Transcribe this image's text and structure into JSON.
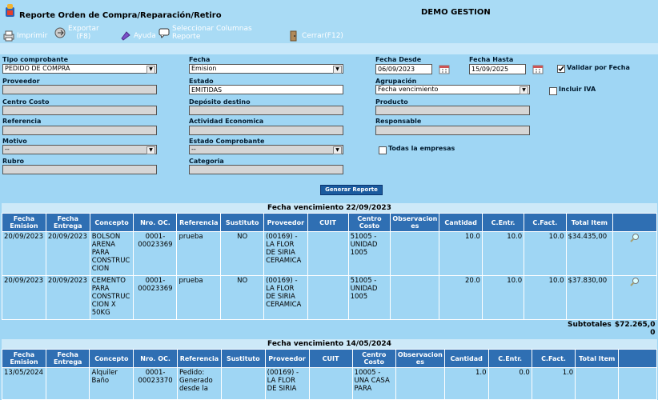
{
  "app": {
    "title": "Reporte Orden de Compra/Reparación/Retiro",
    "company": "DEMO GESTION"
  },
  "toolbar": {
    "print": "Imprimir",
    "export_line1": "Exportar",
    "export_line2": "(F8)",
    "help": "Ayuda",
    "columns_line1": "Seleccionar Columnas",
    "columns_line2": "Reporte",
    "close": "Cerrar(F12)"
  },
  "form": {
    "tipo_comprobante": {
      "label": "Tipo comprobante",
      "value": "PEDIDO DE COMPRA"
    },
    "fecha": {
      "label": "Fecha",
      "value": "Emision"
    },
    "fecha_desde": {
      "label": "Fecha Desde",
      "value": "06/09/2023"
    },
    "fecha_hasta": {
      "label": "Fecha Hasta",
      "value": "15/09/2025"
    },
    "validar_por_fecha": {
      "label": "Validar por Fecha",
      "checked": true
    },
    "proveedor": {
      "label": "Proveedor",
      "value": ""
    },
    "estado": {
      "label": "Estado",
      "value": "EMITIDAS"
    },
    "agrupacion": {
      "label": "Agrupación",
      "value": "Fecha vencimiento"
    },
    "incluir_iva": {
      "label": "Incluir IVA",
      "checked": false
    },
    "centro_costo": {
      "label": "Centro Costo",
      "value": ""
    },
    "deposito_destino": {
      "label": "Depósito destino",
      "value": ""
    },
    "producto": {
      "label": "Producto",
      "value": ""
    },
    "referencia": {
      "label": "Referencia",
      "value": ""
    },
    "actividad_economica": {
      "label": "Actividad Economica",
      "value": ""
    },
    "responsable": {
      "label": "Responsable",
      "value": ""
    },
    "motivo": {
      "label": "Motivo",
      "value": "--"
    },
    "estado_comprobante": {
      "label": "Estado Comprobante",
      "value": "--"
    },
    "todas_empresas": {
      "label": "Todas la empresas",
      "checked": false
    },
    "rubro": {
      "label": "Rubro",
      "value": ""
    },
    "categoria": {
      "label": "Categoria",
      "value": ""
    },
    "generar": "Generar Reporte"
  },
  "columns": [
    "Fecha Emision",
    "Fecha Entrega",
    "Concepto",
    "Nro. OC.",
    "Referencia",
    "Sustituto",
    "Proveedor",
    "CUIT",
    "Centro Costo",
    "Observaciones",
    "Cantidad",
    "C.Entr.",
    "C.Fact.",
    "Total Item"
  ],
  "columns_display": [
    "Fecha\nEmision",
    "Fecha\nEntrega",
    "Concepto",
    "Nro. OC.",
    "Referencia",
    "Sustituto",
    "Proveedor",
    "CUIT",
    "Centro\nCosto",
    "Observacion\nes",
    "Cantidad",
    "C.Entr.",
    "C.Fact.",
    "Total Item"
  ],
  "groups": [
    {
      "title": "Fecha vencimiento 22/09/2023",
      "rows": [
        {
          "emision": "20/09/2023",
          "entrega": "20/09/2023",
          "concepto": "BOLSON ARENA PARA CONSTRUC CION",
          "nro": "0001-00023369",
          "referencia": "prueba",
          "sustituto": "NO",
          "proveedor": "(00169) - LA FLOR DE SIRIA CERAMICA",
          "cuit": "",
          "centro": "51005 - UNIDAD 1005",
          "obs": "",
          "cantidad": "10.0",
          "centr": "10.0",
          "cfact": "10.0",
          "total": "$34.435,00"
        },
        {
          "emision": "20/09/2023",
          "entrega": "20/09/2023",
          "concepto": "CEMENTO PARA CONSTRUC CION X 50KG",
          "nro": "0001-00023369",
          "referencia": "prueba",
          "sustituto": "NO",
          "proveedor": "(00169) - LA FLOR DE SIRIA CERAMICA",
          "cuit": "",
          "centro": "51005 - UNIDAD 1005",
          "obs": "",
          "cantidad": "20.0",
          "centr": "10.0",
          "cfact": "10.0",
          "total": "$37.830,00"
        }
      ],
      "subtotal_label": "Subtotales",
      "subtotal_line1": "$72.265,0",
      "subtotal_line2": "0"
    },
    {
      "title": "Fecha vencimiento 14/05/2024",
      "rows": [
        {
          "emision": "13/05/2024",
          "entrega": "",
          "concepto": "Alquiler Baño",
          "nro": "0001-00023370",
          "referencia": "Pedido: Generado desde la",
          "sustituto": "",
          "proveedor": "(00169) - LA FLOR DE SIRIA",
          "cuit": "",
          "centro": "10005 - UNA CASA PARA",
          "obs": "",
          "cantidad": "1.0",
          "centr": "0.0",
          "cfact": "1.0",
          "total": ""
        }
      ]
    }
  ]
}
